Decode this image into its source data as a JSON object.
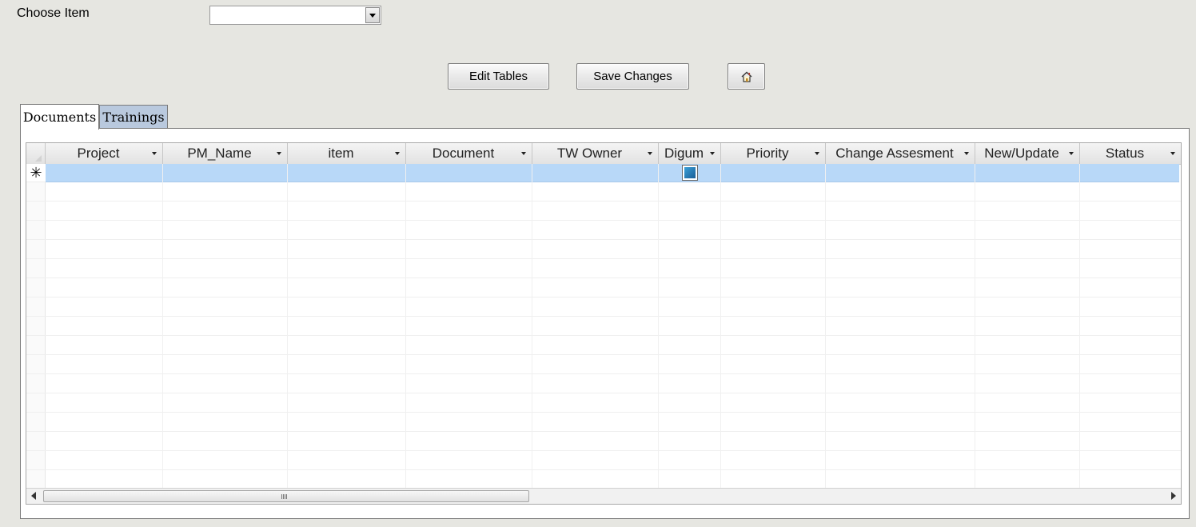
{
  "filter": {
    "label": "Choose Item",
    "value": ""
  },
  "toolbar": {
    "edit_label": "Edit Tables",
    "save_label": "Save Changes",
    "home_icon": "home-icon"
  },
  "tabs": [
    {
      "label": "Documents",
      "active": true
    },
    {
      "label": "Trainings",
      "active": false
    }
  ],
  "grid": {
    "columns": [
      "Project",
      "PM_Name",
      "item",
      "Document",
      "TW Owner",
      "Digum",
      "Priority",
      "Change Assesment",
      "New/Update",
      "Status"
    ],
    "new_row_marker": "✳",
    "new_row_selection_color": "#b8d8f8"
  }
}
